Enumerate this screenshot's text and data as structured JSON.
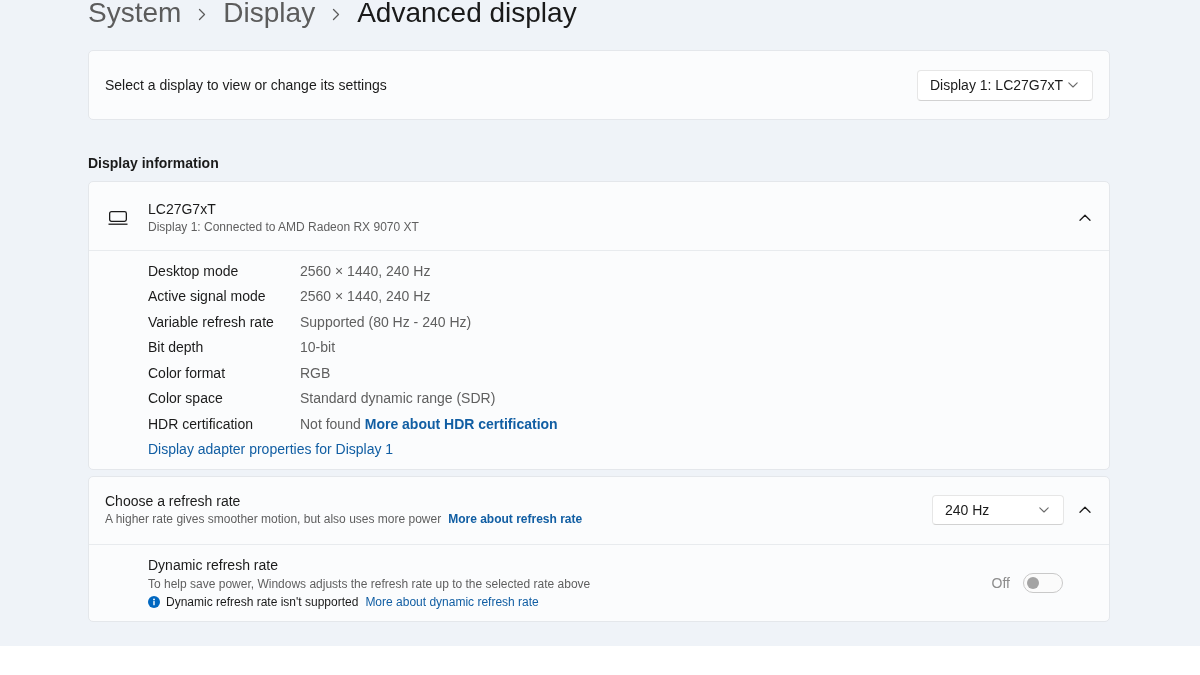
{
  "breadcrumb": [
    {
      "label": "System",
      "current": false
    },
    {
      "label": "Display",
      "current": false
    },
    {
      "label": "Advanced display",
      "current": true
    }
  ],
  "display_selection": {
    "label": "Select a display to view or change its settings",
    "value": "Display 1: LC27G7xT"
  },
  "display_information": {
    "heading": "Display information",
    "monitor": {
      "name": "LC27G7xT",
      "connection": "Display 1: Connected to AMD Radeon RX 9070 XT",
      "expanded": true
    },
    "properties": [
      {
        "label": "Desktop mode",
        "value": "2560 × 1440, 240 Hz"
      },
      {
        "label": "Active signal mode",
        "value": "2560 × 1440, 240 Hz"
      },
      {
        "label": "Variable refresh rate",
        "value": "Supported (80 Hz - 240 Hz)"
      },
      {
        "label": "Bit depth",
        "value": "10-bit"
      },
      {
        "label": "Color format",
        "value": "RGB"
      },
      {
        "label": "Color space",
        "value": "Standard dynamic range (SDR)"
      },
      {
        "label": "HDR certification",
        "value": "Not found",
        "link": "More about HDR certification"
      }
    ],
    "adapter_link": "Display adapter properties for Display 1"
  },
  "refresh_rate": {
    "title": "Choose a refresh rate",
    "description": "A higher rate gives smoother motion, but also uses more power",
    "link": "More about refresh rate",
    "value": "240 Hz",
    "expanded": true,
    "dynamic_refresh_rate": {
      "title": "Dynamic refresh rate",
      "description": "To help save power, Windows adjusts the refresh rate up to the selected rate above",
      "notice": "Dynamic refresh rate isn't supported",
      "notice_link": "More about dynamic refresh rate",
      "toggle_label": "Off",
      "on": false,
      "disabled": true
    }
  }
}
